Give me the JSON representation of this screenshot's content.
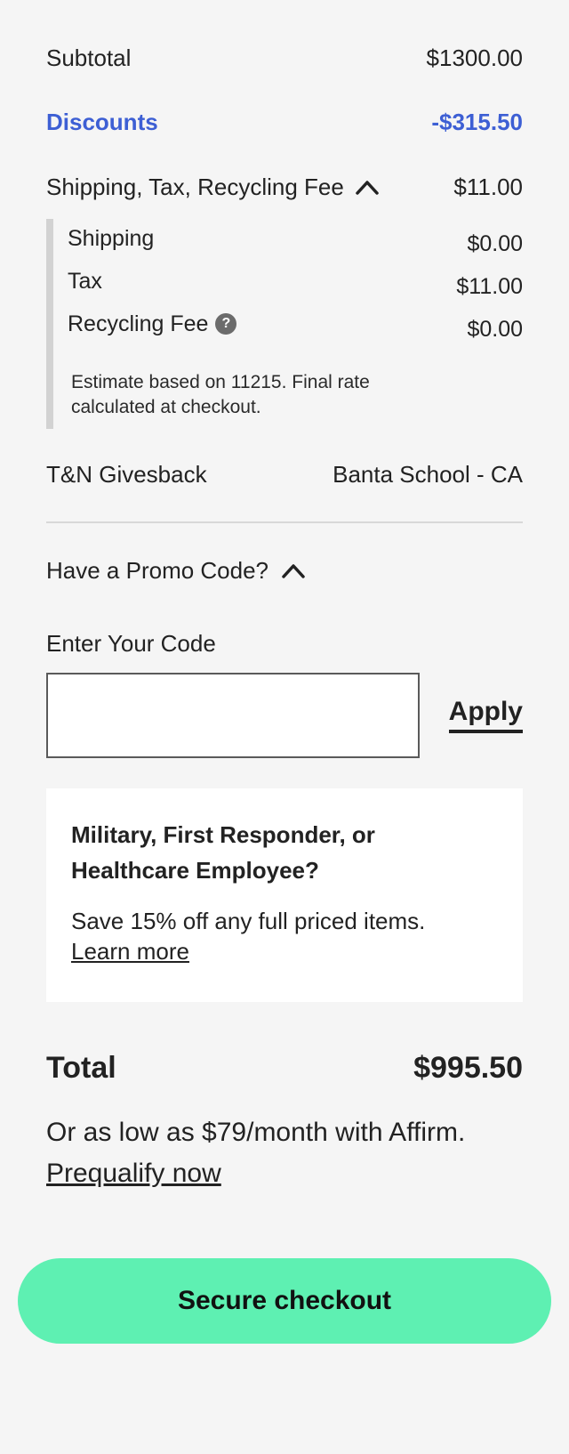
{
  "summary": {
    "subtotal_label": "Subtotal",
    "subtotal_value": "$1300.00",
    "discounts_label": "Discounts",
    "discounts_value": "-$315.50",
    "shipping_group_label": "Shipping, Tax, Recycling Fee",
    "shipping_group_value": "$11.00",
    "shipping_group_expanded": true,
    "breakdown": {
      "shipping_label": "Shipping",
      "shipping_value": "$0.00",
      "tax_label": "Tax",
      "tax_value": "$11.00",
      "recycling_label": "Recycling Fee",
      "recycling_help_icon": "help-icon",
      "recycling_value": "$0.00",
      "estimate_note": "Estimate based on 11215. Final rate calculated at checkout."
    },
    "givesback_label": "T&N Givesback",
    "givesback_value": "Banta School - CA"
  },
  "promo": {
    "toggle_label": "Have a Promo Code?",
    "expanded": true,
    "code_label": "Enter Your Code",
    "code_value": "",
    "code_placeholder": "",
    "apply_label": "Apply"
  },
  "military": {
    "title": "Military, First Responder, or Healthcare Employee?",
    "text": "Save 15% off any full priced items.",
    "link_label": "Learn more"
  },
  "total": {
    "label": "Total",
    "value": "$995.50",
    "affirm_text": "Or as low as $79/month with Affirm.",
    "prequalify_label": "Prequalify now"
  },
  "checkout": {
    "button_label": "Secure checkout"
  },
  "colors": {
    "background": "#f5f5f5",
    "discount_blue": "#3d5fd4",
    "checkout_green": "#5ef0b2",
    "text": "#222222"
  }
}
